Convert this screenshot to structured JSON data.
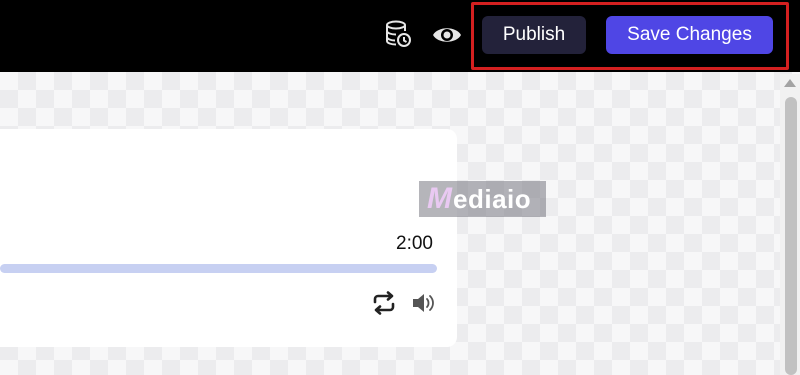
{
  "toolbar": {
    "history_icon": "history-icon",
    "preview_icon": "eye-icon",
    "publish_label": "Publish",
    "save_label": "Save Changes",
    "highlight_color": "#d42020",
    "publish_bg": "#23223a",
    "save_bg": "#4f46e5"
  },
  "player": {
    "duration": "2:00",
    "progress_track_color": "#c7d0f2",
    "repeat_icon": "repeat-icon",
    "volume_icon": "volume-icon"
  },
  "watermark": {
    "logo": "M",
    "text": "ediaio"
  }
}
